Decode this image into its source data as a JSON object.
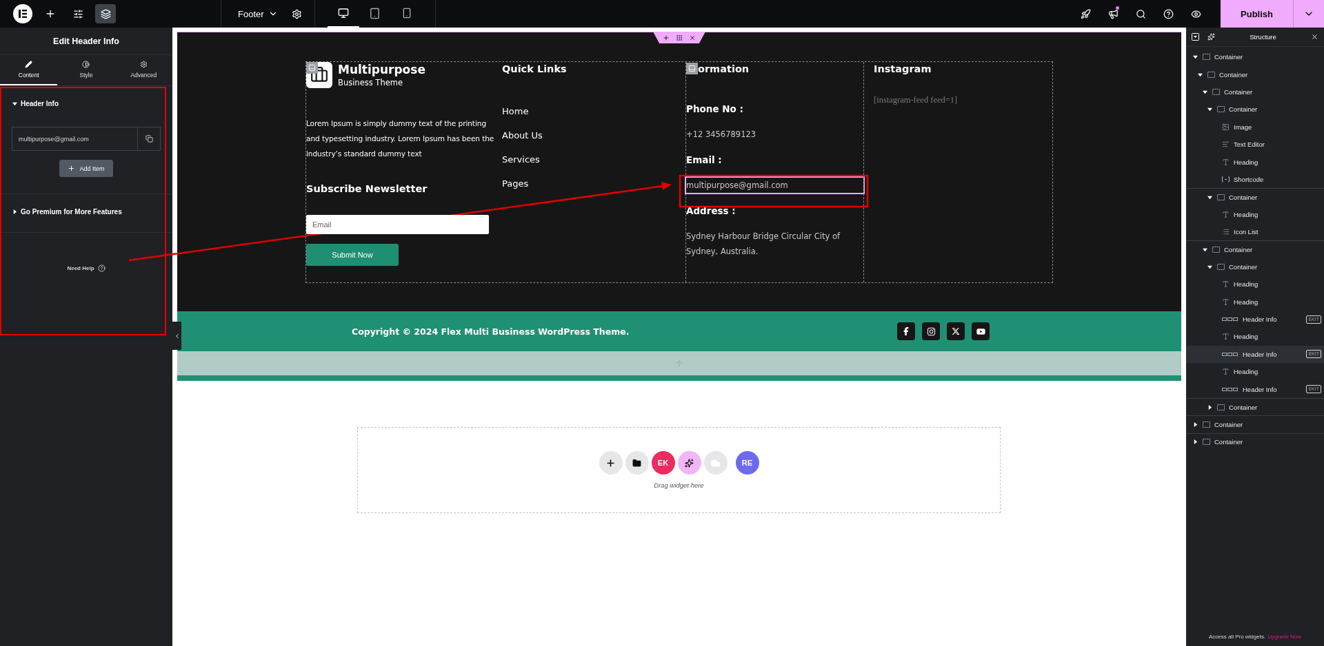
{
  "topbar": {
    "tools": [
      {
        "kind": "add",
        "selected": false
      },
      {
        "kind": "settings",
        "selected": false
      },
      {
        "kind": "structure",
        "selected": true
      }
    ],
    "document": "Footer",
    "devices": [
      {
        "kind": "desktop",
        "selected": true
      },
      {
        "kind": "tablet",
        "selected": false
      },
      {
        "kind": "mobile",
        "selected": false
      }
    ],
    "publish": "Publish"
  },
  "panel": {
    "title": "Edit Header Info",
    "tabs": [
      {
        "kind": "content",
        "label": "Content",
        "selected": true
      },
      {
        "kind": "style",
        "label": "Style",
        "selected": false
      },
      {
        "kind": "advanced",
        "label": "Advanced",
        "selected": false
      }
    ],
    "sections": [
      {
        "title": "Header Info",
        "expanded": true,
        "items": [
          "multipurpose@gmail.com"
        ],
        "add_button": "Add Item"
      },
      {
        "title": "Go Premium for More Features",
        "expanded": false
      }
    ],
    "help": "Need Help"
  },
  "footer": {
    "brand": {
      "name": "Multipurpose",
      "tagline": "Business Theme"
    },
    "description": "Lorem Ipsum is simply dummy text of the printing and typesetting industry. Lorem Ipsum has been the industry’s standard dummy text",
    "newsletter_title": "Subscribe Newsletter",
    "email_placeholder": "Email",
    "submit": "Submit Now",
    "quick_links": {
      "title": "Quick Links",
      "links": [
        "Home",
        "About Us",
        "Services",
        "Pages"
      ]
    },
    "information": {
      "title": "ormation",
      "rows": [
        {
          "kind": "label",
          "text": "Phone No :",
          "selected": false
        },
        {
          "kind": "value",
          "text": "+12 3456789123",
          "selected": false
        },
        {
          "kind": "label",
          "text": "Email :",
          "selected": false
        },
        {
          "kind": "value",
          "text": "multipurpose@gmail.com",
          "selected": true
        },
        {
          "kind": "label",
          "text": "Address :",
          "selected": false
        },
        {
          "kind": "value",
          "text": "Sydney Harbour Bridge Circular City of Sydney, Australia.",
          "selected": false
        }
      ]
    },
    "instagram": {
      "title": "Instagram",
      "shortcode": "[instagram-feed feed=1]"
    },
    "copyright": "Copyright © 2024 Flex Multi Business WordPress Theme.",
    "socials": [
      {
        "kind": "facebook"
      },
      {
        "kind": "instagram"
      },
      {
        "kind": "x"
      },
      {
        "kind": "youtube"
      }
    ]
  },
  "drop_zone": {
    "buttons": [
      {
        "kind": "add"
      },
      {
        "kind": "template"
      },
      {
        "kind": "ek",
        "text": "EK"
      },
      {
        "kind": "ai"
      },
      {
        "kind": "cloud"
      },
      {
        "kind": "re",
        "text": "RE"
      }
    ],
    "hint": "Drag widget here"
  },
  "structure": {
    "title": "Structure",
    "tree": [
      {
        "label": "Container",
        "kind": "container",
        "expanded": true,
        "selected": false,
        "children": [
          {
            "label": "Container",
            "kind": "container",
            "expanded": true,
            "selected": false,
            "children": [
              {
                "label": "Container",
                "kind": "container",
                "expanded": true,
                "selected": false,
                "children": [
                  {
                    "label": "Container",
                    "kind": "container",
                    "expanded": true,
                    "selected": false,
                    "children": [
                      {
                        "label": "Image",
                        "kind": "image",
                        "selected": false
                      },
                      {
                        "label": "Text Editor",
                        "kind": "text-editor",
                        "selected": false
                      },
                      {
                        "label": "Heading",
                        "kind": "heading",
                        "selected": false
                      },
                      {
                        "label": "Shortcode",
                        "kind": "shortcode",
                        "selected": false
                      }
                    ]
                  },
                  {
                    "label": "Container",
                    "kind": "container",
                    "expanded": true,
                    "selected": false,
                    "children": [
                      {
                        "label": "Heading",
                        "kind": "heading",
                        "selected": false
                      },
                      {
                        "label": "Icon List",
                        "kind": "icon-list",
                        "selected": false
                      }
                    ]
                  }
                ]
              },
              {
                "label": "Container",
                "kind": "container",
                "expanded": true,
                "selected": false,
                "children": [
                  {
                    "label": "Container",
                    "kind": "container",
                    "expanded": true,
                    "selected": false,
                    "children": [
                      {
                        "label": "Heading",
                        "kind": "heading",
                        "selected": false
                      },
                      {
                        "label": "Heading",
                        "kind": "heading",
                        "selected": false
                      },
                      {
                        "label": "Header Info",
                        "kind": "header-info",
                        "badge": "EKIT",
                        "selected": false
                      },
                      {
                        "label": "Heading",
                        "kind": "heading",
                        "selected": false
                      },
                      {
                        "label": "Header Info",
                        "kind": "header-info",
                        "badge": "EKIT",
                        "selected": true
                      },
                      {
                        "label": "Heading",
                        "kind": "heading",
                        "selected": false
                      },
                      {
                        "label": "Header Info",
                        "kind": "header-info",
                        "badge": "EKIT",
                        "selected": false
                      }
                    ]
                  },
                  {
                    "label": "Container",
                    "kind": "container",
                    "expanded": false,
                    "selected": false
                  }
                ]
              }
            ]
          }
        ]
      },
      {
        "label": "Container",
        "kind": "container",
        "expanded": false,
        "selected": false
      },
      {
        "label": "Container",
        "kind": "container",
        "expanded": false,
        "selected": false
      }
    ],
    "note": "Access all Pro widgets.",
    "upgrade": "Upgrade Now"
  }
}
